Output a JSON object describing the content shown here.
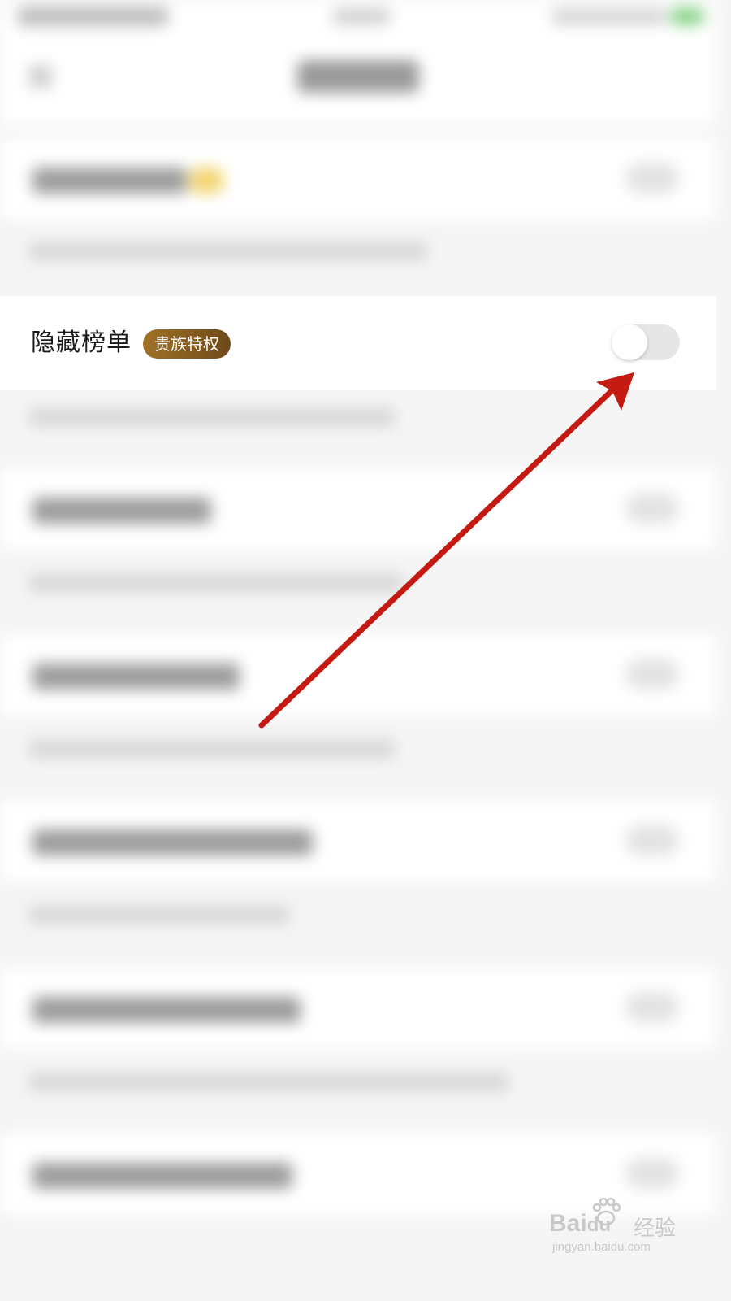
{
  "focus_setting": {
    "title": "隐藏榜单",
    "badge": "贵族特权",
    "toggle_on": false
  },
  "watermark": {
    "brand": "Bai",
    "brand_suffix": "du",
    "product": "经验",
    "url": "jingyan.baidu.com"
  },
  "colors": {
    "badge_gradient_start": "#a07226",
    "badge_gradient_end": "#6e4a1a",
    "toggle_off_track": "#e6e6e6",
    "arrow": "#c41a12",
    "watermark": "#c8c8c8"
  },
  "icons": {
    "arrow": "annotation-arrow",
    "watermark_logo": "baidu-paw-icon"
  }
}
